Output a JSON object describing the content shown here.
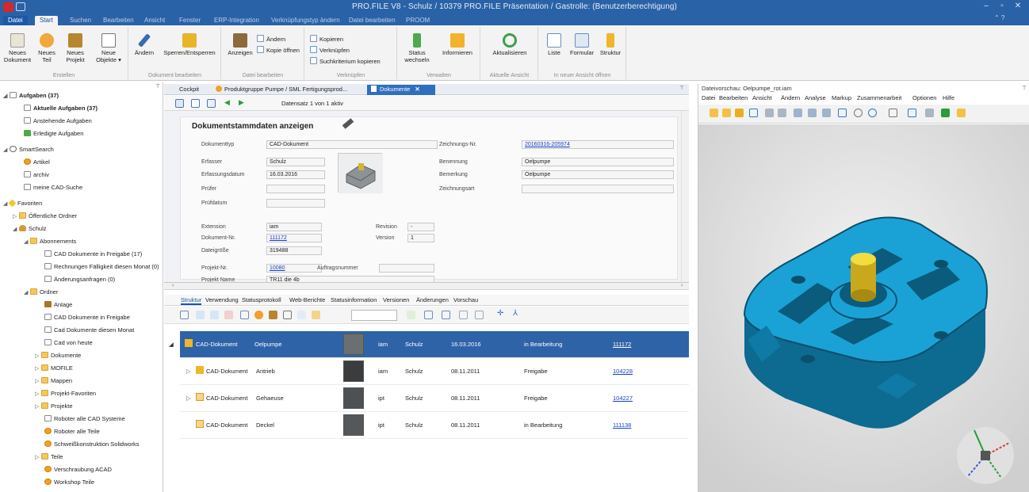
{
  "window": {
    "title": "PRO.FILE V8 - Schulz / 10379 PRO.FILE Präsentation / Gastrolle: (Benutzerberechtigung)"
  },
  "ribbon_tabs": [
    "Datei",
    "Start",
    "Suchen",
    "Bearbeiten",
    "Ansicht",
    "Fenster",
    "ERP-Integration",
    "Verknüpfungstyp ändern",
    "Datei bearbeiten",
    "PROOM"
  ],
  "ribbon": {
    "erstellen": {
      "title": "Erstellen",
      "buttons": [
        "Neues Dokument",
        "Neues Teil",
        "Neues Projekt",
        "Neue Objekte ▾"
      ]
    },
    "dokument_bearbeiten": {
      "title": "Dokument bearbeiten",
      "buttons": [
        "Ändern",
        "Sperren/Entsperren"
      ]
    },
    "datei_bearbeiten": {
      "title": "Datei bearbeiten",
      "buttons": [
        "Anzeigen"
      ],
      "small": [
        "Ändern",
        "Kopie öffnen"
      ]
    },
    "verknuepfen": {
      "title": "Verknüpfen",
      "small": [
        "Kopieren",
        "Verknüpfen",
        "Suchkriterium kopieren"
      ]
    },
    "verwalten": {
      "title": "Verwalten",
      "buttons": [
        "Status wechseln",
        "Informieren"
      ]
    },
    "aktuelle_ansicht": {
      "title": "Aktuelle Ansicht",
      "buttons": [
        "Aktualisieren"
      ]
    },
    "neue_ansicht": {
      "title": "In neuer Ansicht öffnen",
      "buttons": [
        "Liste",
        "Formular",
        "Struktur"
      ]
    }
  },
  "tree": [
    {
      "label": "Aufgaben (37)",
      "bold": true
    },
    {
      "label": "Aktuelle Aufgaben (37)",
      "bold": true
    },
    {
      "label": "Anstehende Aufgaben"
    },
    {
      "label": "Erledigte Aufgaben"
    },
    {
      "label": "SmartSearch"
    },
    {
      "label": "Artikel"
    },
    {
      "label": "archiv"
    },
    {
      "label": "meine CAD-Suche"
    },
    {
      "label": "Favoriten"
    },
    {
      "label": "Öffentliche Ordner"
    },
    {
      "label": "Schulz"
    },
    {
      "label": "Abonnements"
    },
    {
      "label": "CAD Dokumente in Freigabe (17)"
    },
    {
      "label": "Rechnungen Fälligkeit diesen Monat (0)"
    },
    {
      "label": "Änderungsanfragen (0)"
    },
    {
      "label": "Ordner"
    },
    {
      "label": "Anlage"
    },
    {
      "label": "CAD Dokumente in Freigabe"
    },
    {
      "label": "Cad Dokumente diesen Monat"
    },
    {
      "label": "Cad von heute"
    },
    {
      "label": "Dokumente"
    },
    {
      "label": "MOFILE"
    },
    {
      "label": "Mappen"
    },
    {
      "label": "Projekt-Favoriten"
    },
    {
      "label": "Projekte"
    },
    {
      "label": "Roboter alle CAD Systeme"
    },
    {
      "label": "Roboter alle Teile"
    },
    {
      "label": "Schweißkonstruktion Solidworks"
    },
    {
      "label": "Teile"
    },
    {
      "label": "Verschraubung ACAD"
    },
    {
      "label": "Workshop Teile"
    }
  ],
  "doc_tabs": [
    "Cockpit",
    "Produktgruppe Pumpe / SML Fertigungsprod...",
    "Dokumente"
  ],
  "record_nav": "Datensatz 1 von 1 aktiv",
  "form": {
    "heading": "Dokumentstammdaten anzeigen",
    "dokumenttyp": {
      "label": "Dokumenttyp",
      "value": "CAD-Dokument"
    },
    "zeichnungsnr": {
      "label": "Zeichnungs-Nr.",
      "value": "20160316-205974"
    },
    "erfasser": {
      "label": "Erfasser",
      "value": "Schulz"
    },
    "benennung": {
      "label": "Benennung",
      "value": "Oelpumpe"
    },
    "erfassungsdatum": {
      "label": "Erfassungsdatum",
      "value": "16.03.2016"
    },
    "bemerkung": {
      "label": "Bemerkung",
      "value": "Oelpumpe"
    },
    "pruefer": {
      "label": "Prüfer",
      "value": ""
    },
    "zeichnungsart": {
      "label": "Zeichnungsart",
      "value": ""
    },
    "pruefdatum": {
      "label": "Prüfdatum",
      "value": ""
    },
    "extension": {
      "label": "Extension",
      "value": "iam"
    },
    "revision": {
      "label": "Revision",
      "value": "-"
    },
    "dokumentnr": {
      "label": "Dokument-Nr.",
      "value": "111172"
    },
    "version": {
      "label": "Version",
      "value": "1"
    },
    "dateigroesse": {
      "label": "Dateigröße",
      "value": "319488"
    },
    "projektnr": {
      "label": "Projekt-Nr.",
      "value": "10080"
    },
    "auftragsnummer": {
      "label": "Auftragsnummer",
      "value": ""
    },
    "projektname": {
      "label": "Projekt Name",
      "value": "TR11 die 4b"
    }
  },
  "lower_tabs": [
    "Struktur",
    "Verwendung",
    "Statusprotokoll",
    "Web-Berichte",
    "Statusinformation",
    "Versionen",
    "Änderungen",
    "Vorschau"
  ],
  "grid_rows": [
    {
      "typ": "CAD-Dokument",
      "benennung": "Oelpumpe",
      "ext": "iam",
      "erfasser": "Schulz",
      "datum": "16.03.2016",
      "status": "in Bearbeitung",
      "nr": "111172",
      "selected": true
    },
    {
      "typ": "CAD-Dokument",
      "benennung": "Antrieb",
      "ext": "iam",
      "erfasser": "Schulz",
      "datum": "08.11.2011",
      "status": "Freigabe",
      "nr": "104228",
      "selected": false
    },
    {
      "typ": "CAD-Dokument",
      "benennung": "Gehaeuse",
      "ext": "ipt",
      "erfasser": "Schulz",
      "datum": "08.11.2011",
      "status": "Freigabe",
      "nr": "104227",
      "selected": false
    },
    {
      "typ": "CAD-Dokument",
      "benennung": "Deckel",
      "ext": "ipt",
      "erfasser": "Schulz",
      "datum": "08.11.2011",
      "status": "in Bearbeitung",
      "nr": "111138",
      "selected": false
    }
  ],
  "preview": {
    "title": "Dateivorschau: Oelpumpe_rot.iam",
    "menu": [
      "Datei",
      "Bearbeiten",
      "Ansicht",
      "Ändern",
      "Analyse",
      "Markup",
      "Zusammenarbeit",
      "Optionen",
      "Hilfe"
    ]
  },
  "colors": {
    "titlebar": "#2a62a7",
    "selection": "#2f63a8",
    "part": "#1aa2d6",
    "shaft": "#e8c832"
  }
}
